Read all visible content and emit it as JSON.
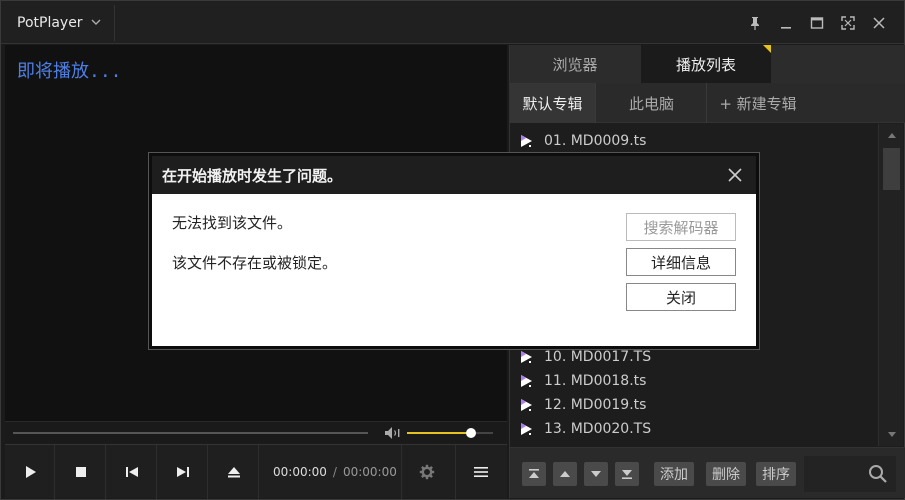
{
  "titlebar": {
    "app_name": "PotPlayer",
    "menu_chevron": "⌵"
  },
  "video": {
    "status_text": "即将播放..."
  },
  "playback": {
    "current_time": "00:00:00",
    "separator": "/",
    "duration": "00:00:00",
    "volume_level": 0.74
  },
  "panel": {
    "tabs": [
      {
        "label": "浏览器"
      },
      {
        "label": "播放列表"
      }
    ],
    "subtabs": [
      {
        "label": "默认专辑"
      },
      {
        "label": "此电脑"
      },
      {
        "label": "+ 新建专辑"
      }
    ],
    "playlist": [
      {
        "label": "01. MD0009.ts"
      },
      {
        "label": "10. MD0017.TS"
      },
      {
        "label": "11. MD0018.ts"
      },
      {
        "label": "12. MD0019.ts"
      },
      {
        "label": "13. MD0020.TS"
      }
    ],
    "bottom": {
      "add_label": "添加",
      "delete_label": "删除",
      "sort_label": "排序"
    }
  },
  "dialog": {
    "title": "在开始播放时发生了问题。",
    "message1": "无法找到该文件。",
    "message2": "该文件不存在或被锁定。",
    "btn_search_codec": "搜索解码器",
    "btn_details": "详细信息",
    "btn_close": "关闭"
  },
  "colors": {
    "accent": "#e5c21f",
    "status_text": "#4d7fe6",
    "play_icon": "#b07cff"
  }
}
